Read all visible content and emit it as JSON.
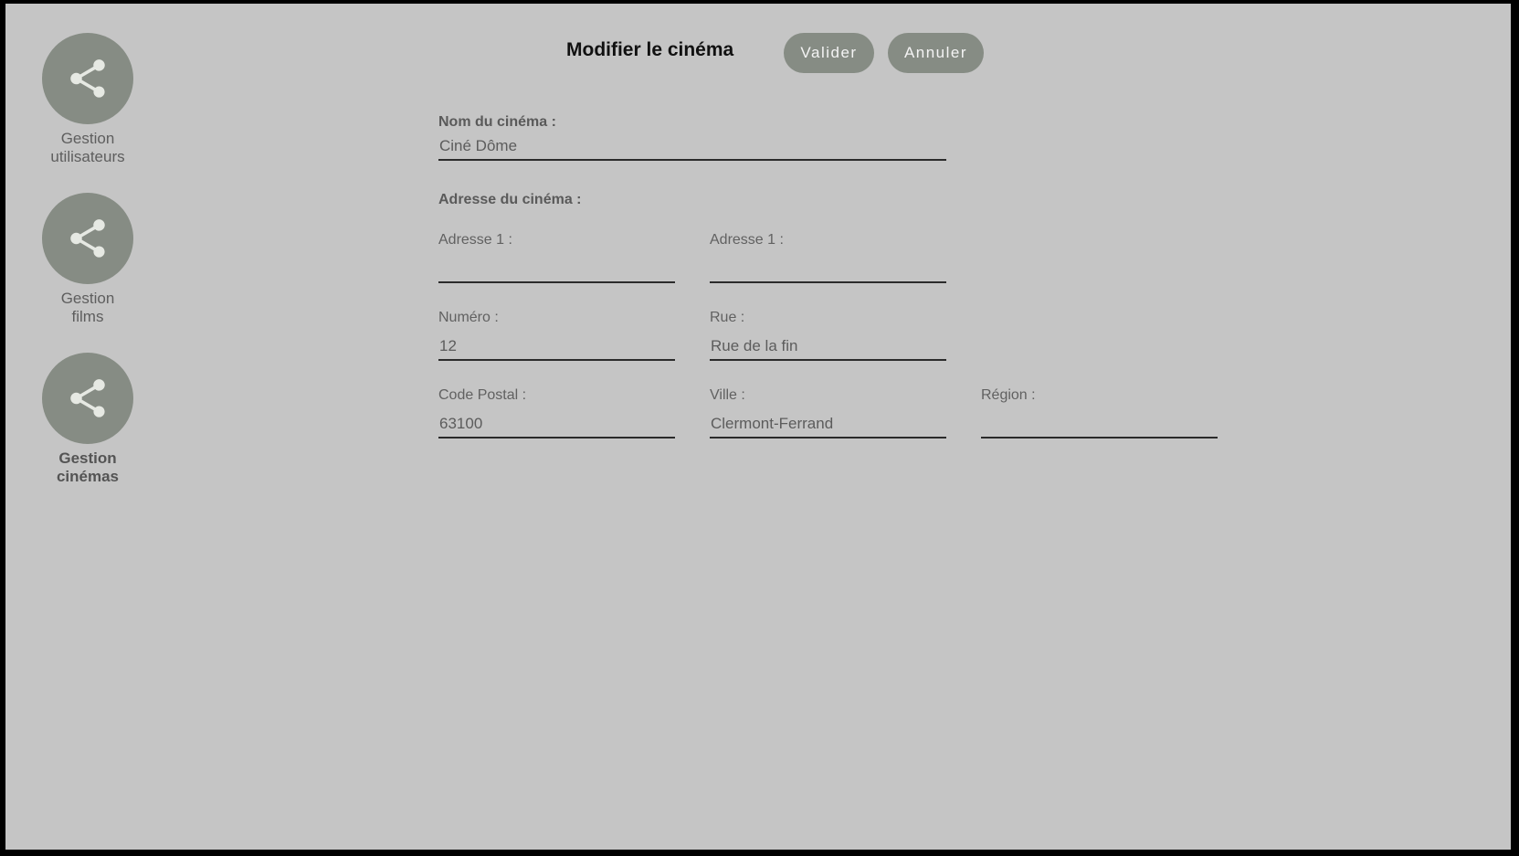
{
  "sidebar": {
    "items": [
      {
        "label": "Gestion\nutilisateurs",
        "icon": "share-icon",
        "active": false
      },
      {
        "label": "Gestion\nfilms",
        "icon": "share-icon",
        "active": false
      },
      {
        "label": "Gestion\ncinémas",
        "icon": "share-icon",
        "active": true
      }
    ]
  },
  "header": {
    "title": "Modifier le cinéma",
    "valider_label": "Valider",
    "annuler_label": "Annuler"
  },
  "form": {
    "name_section_label": "Nom du cinéma :",
    "name_value": "Ciné Dôme",
    "address_section_label": "Adresse du cinéma :",
    "adresse1_label": "Adresse 1 :",
    "adresse1_value": "",
    "adresse2_label": "Adresse 1 :",
    "adresse2_value": "",
    "numero_label": "Numéro :",
    "numero_value": "12",
    "rue_label": "Rue :",
    "rue_value": "Rue de la fin",
    "code_postal_label": "Code Postal :",
    "code_postal_value": "63100",
    "ville_label": "Ville :",
    "ville_value": "Clermont-Ferrand",
    "region_label": "Région :",
    "region_value": ""
  },
  "colors": {
    "background": "#c5c5c5",
    "accent": "#868c84",
    "icon": "#e6e9e3"
  }
}
